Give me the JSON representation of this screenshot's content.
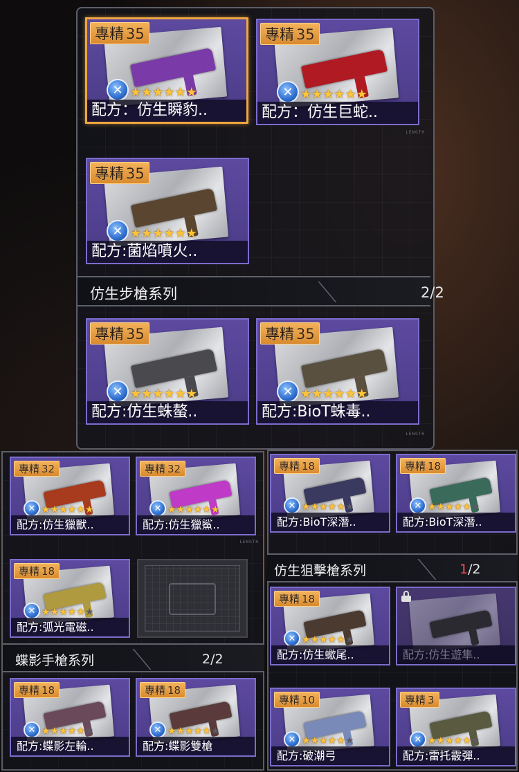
{
  "colors": {
    "card_purple": "#5d4aa0",
    "badge_orange": "#e89a3c",
    "star_gold": "#ffc53a",
    "count_highlight": "#ff4b55",
    "selected_border": "#f0a640"
  },
  "length_tag": "LENGTH",
  "badge_prefix": "專精",
  "panel_top": {
    "cards": [
      {
        "level": "35",
        "label": "配方：仿生瞬豹..",
        "stars": 6,
        "max_stars": 6,
        "selected": true,
        "weapon_color": "#7a3aa8"
      },
      {
        "level": "35",
        "label": "配方：仿生巨蛇..",
        "stars": 6,
        "max_stars": 6,
        "selected": false,
        "weapon_color": "#b01a22"
      },
      {
        "level": "35",
        "label": "配方:菌焰噴火..",
        "stars": 6,
        "max_stars": 6,
        "selected": false,
        "weapon_color": "#5a4630"
      }
    ],
    "series": {
      "title": "仿生步槍系列",
      "count_owned": "2",
      "count_total": "/2"
    },
    "series_cards": [
      {
        "level": "35",
        "label": "配方:仿生蛛螯..",
        "stars": 6,
        "max_stars": 6,
        "selected": false,
        "weapon_color": "#4a4a4e"
      },
      {
        "level": "35",
        "label": "配方:BioT蛛毒..",
        "stars": 6,
        "max_stars": 6,
        "selected": false,
        "weapon_color": "#5a5040"
      }
    ]
  },
  "panel_left": {
    "cards_row1": [
      {
        "level": "32",
        "label": "配方:仿生獵獸..",
        "stars": 6,
        "max_stars": 6,
        "weapon_color": "#a83a1e"
      },
      {
        "level": "32",
        "label": "配方:仿生獵鯊..",
        "stars": 6,
        "max_stars": 6,
        "weapon_color": "#c03ac8"
      }
    ],
    "cards_row2": [
      {
        "level": "18",
        "label": "配方:弧光電磁..",
        "stars": 5,
        "max_stars": 6,
        "weapon_color": "#b09a40"
      }
    ],
    "series": {
      "title": "蝶影手槍系列",
      "count_owned": "2",
      "count_total": "/2"
    },
    "series_cards": [
      {
        "level": "18",
        "label": "配方:蝶影左輪..",
        "stars": 5,
        "max_stars": 6,
        "weapon_color": "#6a4a5a"
      },
      {
        "level": "18",
        "label": "配方:蝶影雙槍",
        "stars": 5,
        "max_stars": 6,
        "weapon_color": "#5a3a3a"
      }
    ]
  },
  "panel_right": {
    "cards_row1": [
      {
        "level": "18",
        "label": "配方:BioT深潛..",
        "stars": 5,
        "max_stars": 6,
        "weapon_color": "#3a3a60"
      },
      {
        "level": "18",
        "label": "配方:BioT深潛..",
        "stars": 5,
        "max_stars": 6,
        "weapon_color": "#3a6a5a"
      }
    ],
    "series": {
      "title": "仿生狙擊槍系列",
      "count_owned": "1",
      "count_total": "/2"
    },
    "series_cards": [
      {
        "level": "18",
        "label": "配方:仿生蠍尾..",
        "stars": 5,
        "max_stars": 6,
        "weapon_color": "#4a3a30",
        "locked": false
      },
      {
        "level": "",
        "label": "配方:仿生遊隼..",
        "stars": 0,
        "max_stars": 0,
        "weapon_color": "#2a2a30",
        "locked": true
      }
    ],
    "cards_row3": [
      {
        "level": "10",
        "label": "配方:破潮弓",
        "stars": 5,
        "max_stars": 6,
        "weapon_color": "#7a8ab8"
      },
      {
        "level": "3",
        "label": "配方:雷托霰彈..",
        "stars": 5,
        "max_stars": 6,
        "weapon_color": "#5a5a40"
      }
    ]
  }
}
